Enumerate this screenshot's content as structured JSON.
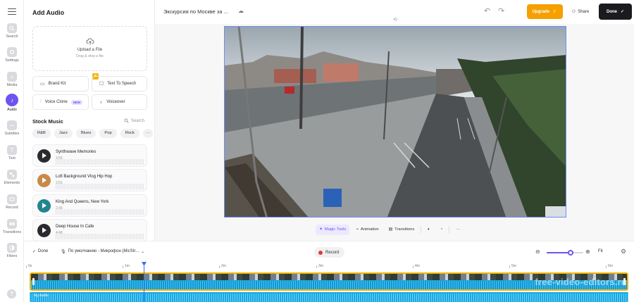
{
  "nav": {
    "items": [
      {
        "label": "Search",
        "icon": "search-icon"
      },
      {
        "label": "Settings",
        "icon": "gear-icon"
      },
      {
        "label": "Media",
        "icon": "plus-icon"
      },
      {
        "label": "Audio",
        "icon": "music-note-icon",
        "active": true
      },
      {
        "label": "Subtitles",
        "icon": "subtitles-icon"
      },
      {
        "label": "Text",
        "icon": "text-icon"
      },
      {
        "label": "Elements",
        "icon": "elements-icon"
      },
      {
        "label": "Record",
        "icon": "record-icon"
      },
      {
        "label": "Transitions",
        "icon": "transitions-icon"
      },
      {
        "label": "Filters",
        "icon": "filters-icon"
      }
    ],
    "help_label": "?"
  },
  "panel": {
    "title": "Add Audio",
    "upload_title": "Upload a File",
    "upload_sub": "Drag & drop a file",
    "tools": {
      "brand_kit": "Brand Kit",
      "text_to_speech": "Text To Speech",
      "voice_clone": "Voice Clone",
      "voice_clone_badge": "NEW",
      "voiceover": "Voiceover"
    },
    "stock_title": "Stock Music",
    "stock_search": "Search",
    "chips": [
      "R&B",
      "Jazz",
      "Blues",
      "Pop",
      "Rock"
    ],
    "chips_more": "···",
    "tracks": [
      {
        "name": "Synthwave Memories",
        "duration": "2:56"
      },
      {
        "name": "Lofi Background Vlog Hip Hop",
        "duration": "2:01"
      },
      {
        "name": "King And Queens, New York",
        "duration": "2:36"
      },
      {
        "name": "Deep House In Cafe",
        "duration": "4:48"
      }
    ]
  },
  "topbar": {
    "doc_title": "Экскурсия по Москве за ...",
    "upgrade_label": "Upgrade",
    "share_label": "Share",
    "done_label": "Done"
  },
  "toolbar": {
    "magic_tools": "Magic Tools",
    "animation": "Animation",
    "transitions": "Transitions"
  },
  "timeline": {
    "done_label": "Done",
    "mic_label": "По умолчанию - Микрофон (MicStr...",
    "record_label": "Record",
    "fit_label": "Fit",
    "zoom_level": 0.66,
    "ruler": [
      "0s",
      "1m",
      "2m",
      "3m",
      "4m",
      "5m",
      "6m"
    ],
    "watermark": "free-video-editors.ru",
    "audio_label": "My Audio"
  },
  "colors": {
    "accent": "#6c54f0",
    "upgrade": "#f5a000",
    "clip_border": "#f5b400",
    "audio_track": "#19a9e2",
    "record_dot": "#e53935"
  }
}
